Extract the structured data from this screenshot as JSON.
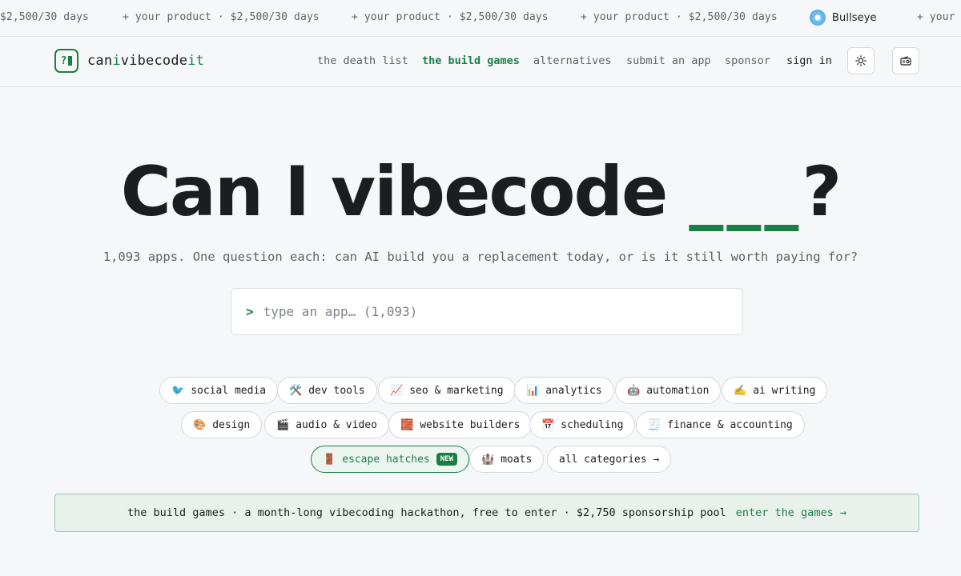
{
  "ticker": {
    "items": [
      "$2,500/30 days",
      "+ your product · $2,500/30 days",
      "+ your product · $2,500/30 days",
      "+ your product · $2,500/30 days",
      "+ your"
    ],
    "sponsor_name": "Bullseye"
  },
  "nav": {
    "logo_prefix": "can",
    "logo_i": "i",
    "logo_mid": "vibecode",
    "logo_suffix": "it",
    "links": [
      "the death list",
      "the build games",
      "alternatives",
      "submit an app",
      "sponsor",
      "sign in"
    ],
    "active_link": "the build games",
    "theme_icon": "sun-icon",
    "radio_icon": "radio-icon"
  },
  "hero": {
    "title": "Can I vibecode",
    "blank": "___",
    "question_mark": "?",
    "subtitle": "1,093 apps. One question each: can AI build you a replacement today, or is it still worth paying for?"
  },
  "search": {
    "prompt": ">",
    "placeholder": "type an app… (1,093)"
  },
  "categories": {
    "row1": [
      {
        "icon": "🐦",
        "label": "social media"
      },
      {
        "icon": "🛠️",
        "label": "dev tools"
      },
      {
        "icon": "📈",
        "label": "seo & marketing"
      },
      {
        "icon": "📊",
        "label": "analytics"
      },
      {
        "icon": "🤖",
        "label": "automation"
      },
      {
        "icon": "✍️",
        "label": "ai writing"
      }
    ],
    "row2": [
      {
        "icon": "🎨",
        "label": "design"
      },
      {
        "icon": "🎬",
        "label": "audio & video"
      },
      {
        "icon": "🧱",
        "label": "website builders"
      },
      {
        "icon": "📅",
        "label": "scheduling"
      },
      {
        "icon": "🧾",
        "label": "finance & accounting"
      }
    ],
    "row3": [
      {
        "icon": "🚪",
        "label": "escape hatches",
        "badge": "NEW"
      },
      {
        "icon": "🏰",
        "label": "moats"
      },
      {
        "label": "all categories →"
      }
    ]
  },
  "banner": {
    "text": "the build games · a month-long vibecoding hackathon, free to enter · $2,750 sponsorship pool",
    "cta": "enter the games →"
  },
  "colors": {
    "accent": "#1a7f45",
    "background": "#f6f7f9",
    "text": "#1b1d21",
    "muted": "#5d6168"
  }
}
